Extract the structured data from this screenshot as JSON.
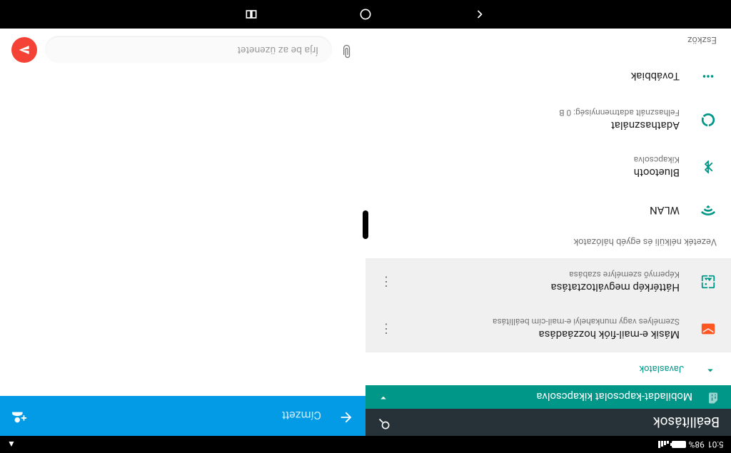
{
  "status": {
    "time": "5:01",
    "battery": "98%",
    "cast_icon": "▲"
  },
  "settings": {
    "title": "Beállítások",
    "banner": "Mobiladat-kapcsolat kikapcsolva",
    "suggestions_label": "Javaslatok",
    "suggestions": [
      {
        "title": "Másik e-mail-fiók hozzáadása",
        "subtitle": "Személyes vagy munkahelyi e-mail-cím beállítása"
      },
      {
        "title": "Háttérkép megváltoztatása",
        "subtitle": "Képernyő személyre szabása"
      }
    ],
    "section_wireless": "Vezeték nélküli és egyéb hálózatok",
    "items": [
      {
        "title": "WLAN",
        "subtitle": ""
      },
      {
        "title": "Bluetooth",
        "subtitle": "Kikapcsolva"
      },
      {
        "title": "Adathasználat",
        "subtitle": "Felhasznált adatmennyiség: 0 B"
      },
      {
        "title": "Továbbiak",
        "subtitle": ""
      }
    ],
    "section_device": "Eszköz"
  },
  "messaging": {
    "recipient_placeholder": "Címzett",
    "compose_placeholder": "Írja be az üzenetet"
  }
}
